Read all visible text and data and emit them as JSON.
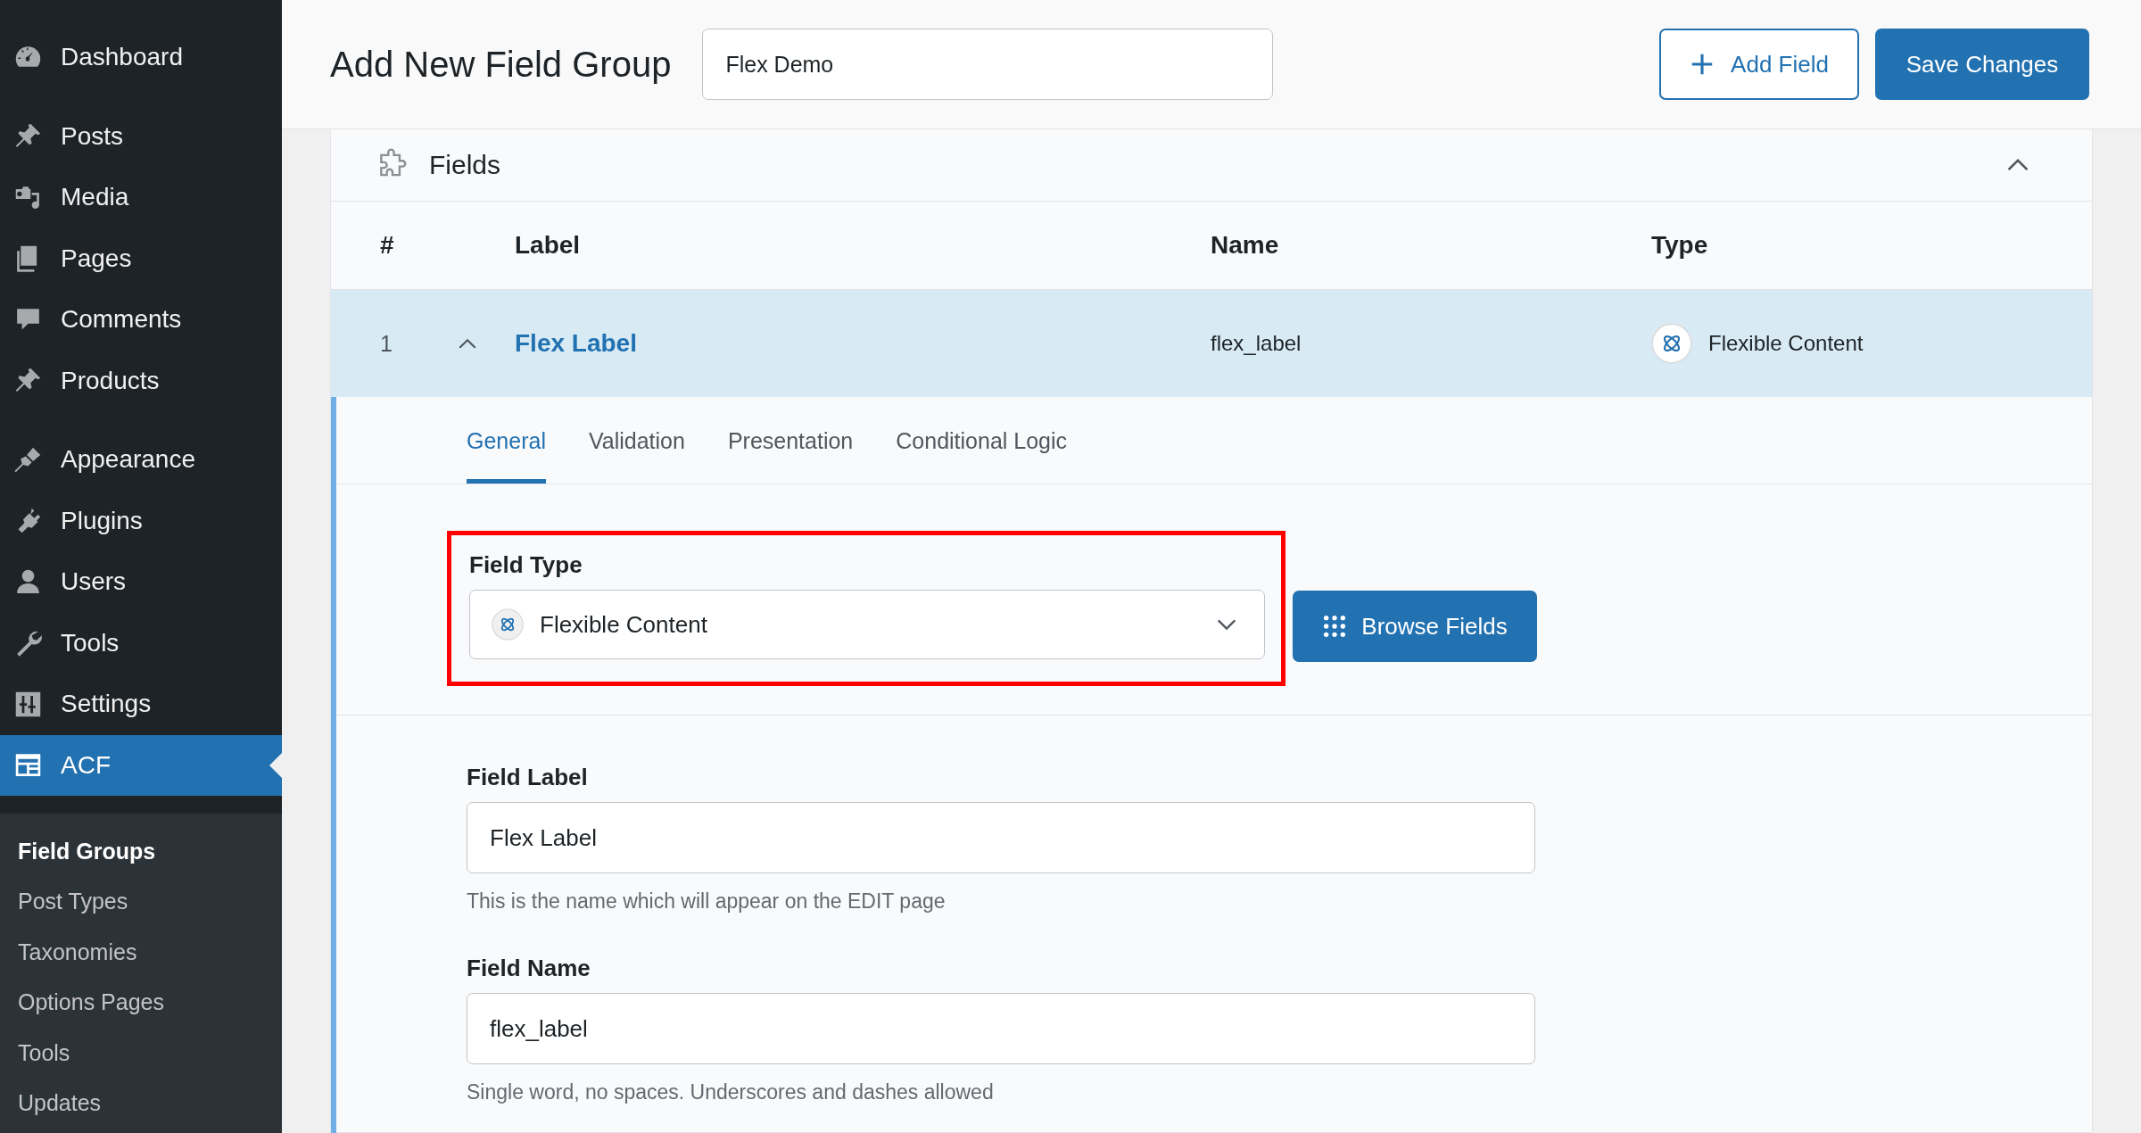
{
  "sidebar": {
    "groups": [
      {
        "items": [
          {
            "label": "Dashboard",
            "selected": false
          }
        ]
      },
      {
        "items": [
          {
            "label": "Posts",
            "selected": false
          },
          {
            "label": "Media",
            "selected": false
          },
          {
            "label": "Pages",
            "selected": false
          },
          {
            "label": "Comments",
            "selected": false
          },
          {
            "label": "Products",
            "selected": false
          }
        ]
      },
      {
        "items": [
          {
            "label": "Appearance",
            "selected": false
          },
          {
            "label": "Plugins",
            "selected": false
          },
          {
            "label": "Users",
            "selected": false
          },
          {
            "label": "Tools",
            "selected": false
          },
          {
            "label": "Settings",
            "selected": false
          },
          {
            "label": "ACF",
            "selected": true
          }
        ]
      }
    ],
    "submenu": [
      {
        "label": "Field Groups",
        "selected": true
      },
      {
        "label": "Post Types",
        "selected": false
      },
      {
        "label": "Taxonomies",
        "selected": false
      },
      {
        "label": "Options Pages",
        "selected": false
      },
      {
        "label": "Tools",
        "selected": false
      },
      {
        "label": "Updates",
        "selected": false
      }
    ]
  },
  "header": {
    "title": "Add New Field Group",
    "group_name": "Flex Demo",
    "add_button": "Add Field",
    "save_button": "Save Changes"
  },
  "fields_panel": {
    "title": "Fields",
    "expanded": true,
    "columns": [
      "#",
      "Label",
      "Name",
      "Type"
    ],
    "rows": [
      {
        "number": "1",
        "label": "Flex Label",
        "name": "flex_label",
        "type": "Flexible Content",
        "expanded": true
      }
    ],
    "tabs": [
      {
        "label": "General",
        "selected": true
      },
      {
        "label": "Validation",
        "selected": false
      },
      {
        "label": "Presentation",
        "selected": false
      },
      {
        "label": "Conditional Logic",
        "selected": false
      }
    ],
    "field_type": {
      "label": "Field Type",
      "value": "Flexible Content",
      "highlighted": true,
      "browse_button": "Browse Fields"
    },
    "settings": [
      {
        "label": "Field Label",
        "value": "Flex Label",
        "help": "This is the name which will appear on the EDIT page"
      },
      {
        "label": "Field Name",
        "value": "flex_label",
        "help": "Single word, no spaces. Underscores and dashes allowed"
      }
    ]
  }
}
